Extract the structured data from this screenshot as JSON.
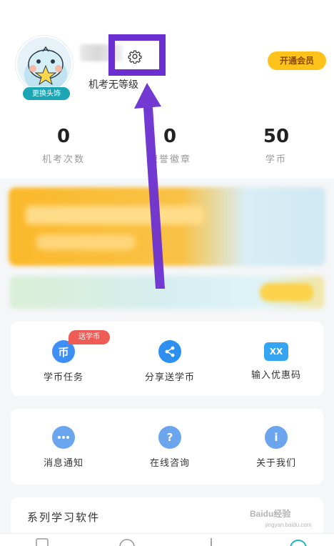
{
  "profile": {
    "avatar_button": "更换头饰",
    "level": "机考无等级",
    "vip_button": "开通会员"
  },
  "stats": [
    {
      "value": "0",
      "label": "机考次数"
    },
    {
      "value": "0",
      "label": "荣誉徽章"
    },
    {
      "value": "50",
      "label": "学币"
    }
  ],
  "card1": {
    "badge": "送学币",
    "items": [
      {
        "icon": "币",
        "label": "学币任务",
        "color": "#3d8ef5"
      },
      {
        "icon": "share",
        "label": "分享送学币",
        "color": "#2d8ff0"
      },
      {
        "icon": "XX",
        "label": "输入优惠码",
        "color": "#35a4f3"
      }
    ]
  },
  "card2": {
    "items": [
      {
        "icon": "chat-dots",
        "label": "消息通知",
        "color": "#6aa5ee"
      },
      {
        "icon": "?",
        "label": "在线咨询",
        "color": "#6aa5ee"
      },
      {
        "icon": "i",
        "label": "关于我们",
        "color": "#6aa5ee"
      }
    ]
  },
  "series": {
    "title": "系列学习软件"
  },
  "watermark": {
    "text": "Baidu经验",
    "sub": "jingyan.baidu.com"
  },
  "colors": {
    "highlight": "#6b2fd1",
    "vip": "#ffc21a",
    "badge": "#ef5c56"
  }
}
